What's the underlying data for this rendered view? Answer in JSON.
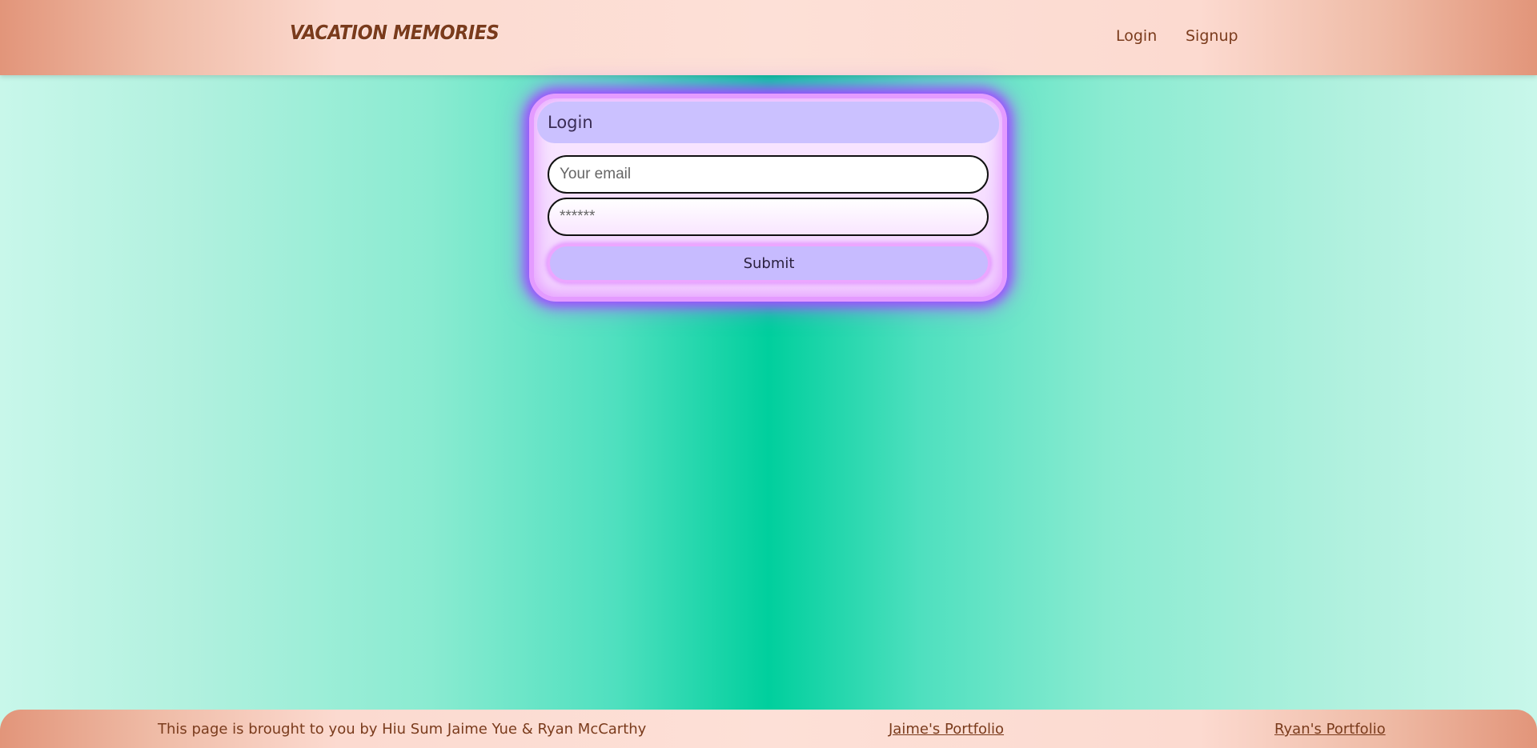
{
  "header": {
    "brand": "VACATION MEMORIES",
    "nav": {
      "login": "Login",
      "signup": "Signup"
    }
  },
  "login_card": {
    "title": "Login",
    "email_placeholder": "Your email",
    "password_placeholder": "******",
    "submit_label": "Submit"
  },
  "footer": {
    "credit": "This page is brought to you by Hiu Sum Jaime Yue & Ryan McCarthy",
    "links": {
      "jaime": "Jaime's Portfolio",
      "ryan": "Ryan's Portfolio"
    }
  },
  "colors": {
    "accent_text": "#7a3b1c",
    "card_glow": "#9b4dff",
    "card_header": "#cbc1ff",
    "background_center": "#00cf9d"
  }
}
